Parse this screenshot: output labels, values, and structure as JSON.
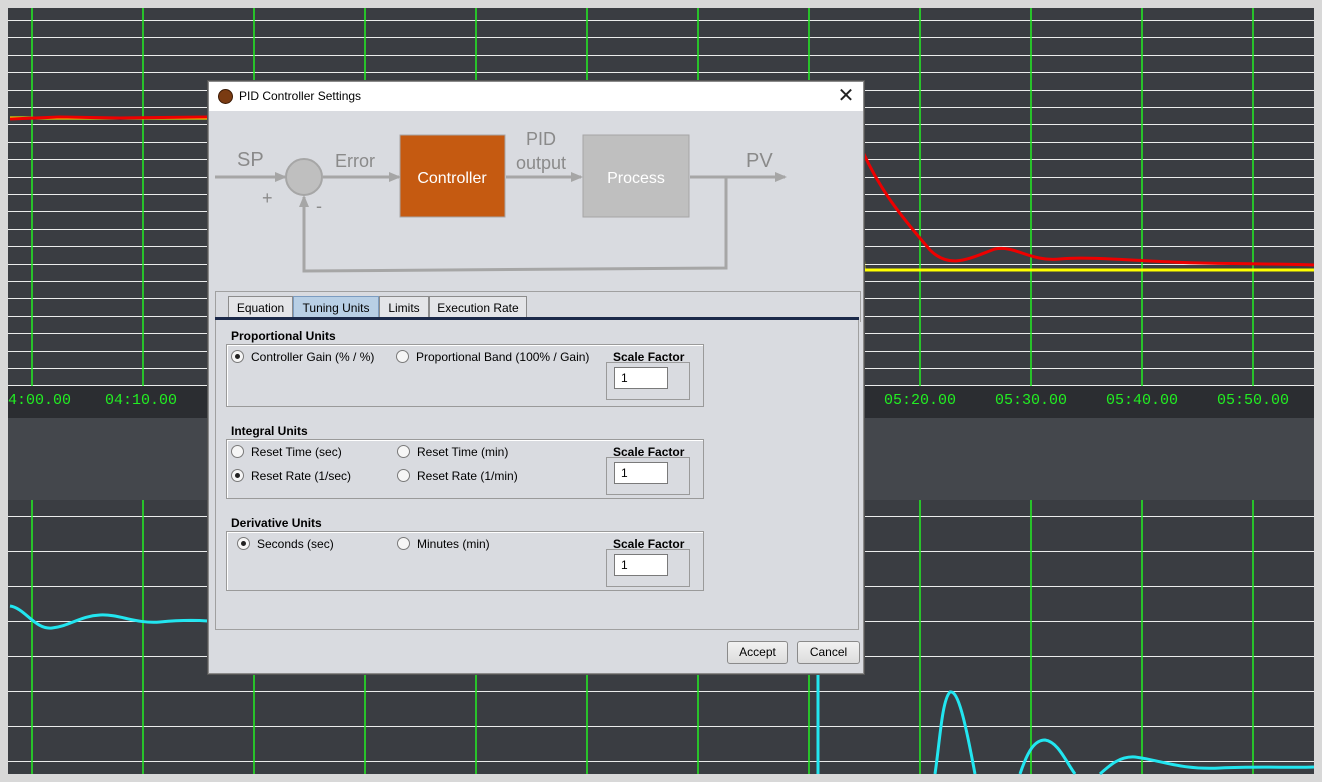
{
  "window": {
    "title": "PID Controller Settings",
    "close_glyph": "✕"
  },
  "diagram": {
    "sp": "SP",
    "plus": "+",
    "minus": "-",
    "error": "Error",
    "controller": "Controller",
    "pid_output_line1": "PID",
    "pid_output_line2": "output",
    "process": "Process",
    "pv": "PV",
    "colors": {
      "controller": "#c55a11",
      "process": "#bfbfbf",
      "lines": "#a6a6a6"
    }
  },
  "tabs": [
    {
      "label": "Equation",
      "active": false
    },
    {
      "label": "Tuning Units",
      "active": true
    },
    {
      "label": "Limits",
      "active": false
    },
    {
      "label": "Execution Rate",
      "active": false
    }
  ],
  "proportional": {
    "title": "Proportional Units",
    "options": [
      {
        "label": "Controller Gain (% / %)",
        "selected": true
      },
      {
        "label": "Proportional Band (100% / Gain)",
        "selected": false
      }
    ],
    "scale_factor_label": "Scale Factor",
    "scale_factor_value": "1"
  },
  "integral": {
    "title": "Integral Units",
    "options": [
      {
        "label": "Reset Time (sec)",
        "selected": false
      },
      {
        "label": "Reset Time (min)",
        "selected": false
      },
      {
        "label": "Reset Rate (1/sec)",
        "selected": true
      },
      {
        "label": "Reset Rate (1/min)",
        "selected": false
      }
    ],
    "scale_factor_label": "Scale Factor",
    "scale_factor_value": "1"
  },
  "derivative": {
    "title": "Derivative Units",
    "options": [
      {
        "label": "Seconds (sec)",
        "selected": true
      },
      {
        "label": "Minutes (min)",
        "selected": false
      }
    ],
    "scale_factor_label": "Scale Factor",
    "scale_factor_value": "1"
  },
  "buttons": {
    "accept": "Accept",
    "cancel": "Cancel"
  },
  "background_chart": {
    "time_labels": [
      "4:00.00",
      "04:10.00",
      "05:20.00",
      "05:30.00",
      "05:40.00",
      "05:50.00"
    ],
    "colors": {
      "background": "#3a3d42",
      "grid_vertical": "#22ee22",
      "grid_horizontal": "#ffffff",
      "setpoint": "#ffff00",
      "process_variable": "#ee0000",
      "output": "#22e6f0"
    }
  }
}
